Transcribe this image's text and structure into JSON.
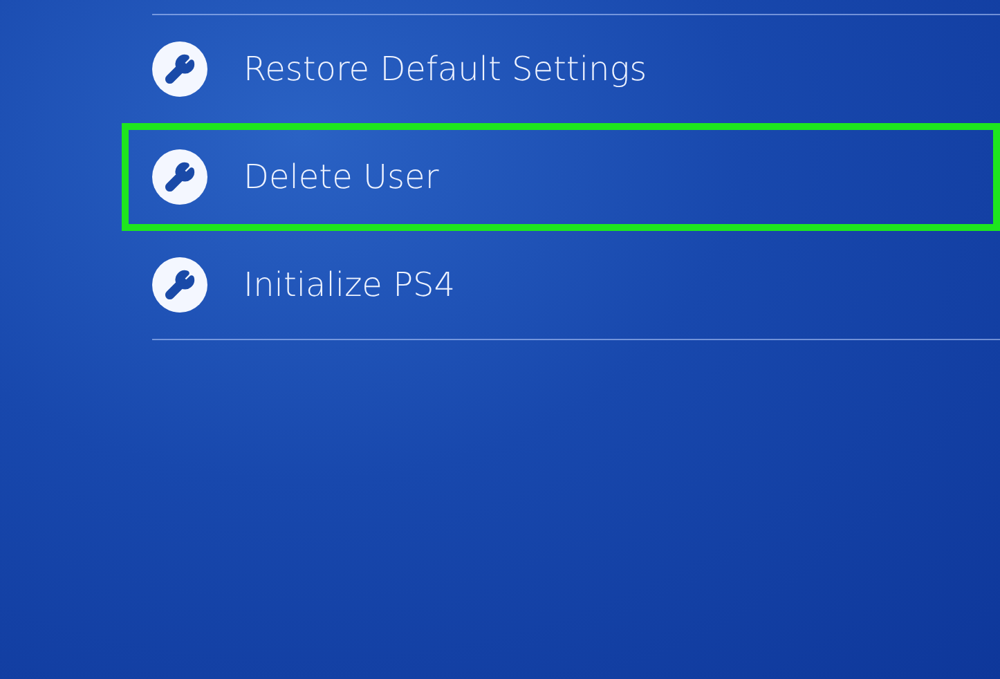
{
  "menu": {
    "items": [
      {
        "label": "Restore Default Settings",
        "selected": false
      },
      {
        "label": "Delete User",
        "selected": true
      },
      {
        "label": "Initialize PS4",
        "selected": false
      }
    ]
  }
}
